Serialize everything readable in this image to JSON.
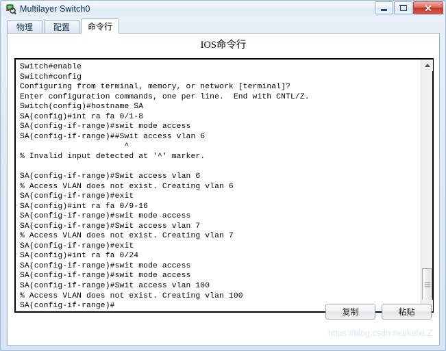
{
  "window": {
    "title": "Multilayer Switch0",
    "icon": "switch-device-icon",
    "controls": {
      "minimize": "minimize-icon",
      "maximize": "maximize-icon",
      "close": "✕"
    }
  },
  "tabs": [
    {
      "label": "物理",
      "active": false
    },
    {
      "label": "配置",
      "active": false
    },
    {
      "label": "命令行",
      "active": true
    }
  ],
  "panel": {
    "title": "IOS命令行"
  },
  "terminal": {
    "lines": [
      "Switch#enable",
      "Switch#config",
      "Configuring from terminal, memory, or network [terminal]?",
      "Enter configuration commands, one per line.  End with CNTL/Z.",
      "Switch(config)#hostname SA",
      "SA(config)#int ra fa 0/1-8",
      "SA(config-if-range)#swit mode access",
      "SA(config-if-range)##Swit access vlan 6",
      "                      ^",
      "% Invalid input detected at '^' marker.",
      "",
      "SA(config-if-range)#Swit access vlan 6",
      "% Access VLAN does not exist. Creating vlan 6",
      "SA(config-if-range)#exit",
      "SA(config)#int ra fa 0/9-16",
      "SA(config-if-range)#swit mode access",
      "SA(config-if-range)#Swit access vlan 7",
      "% Access VLAN does not exist. Creating vlan 7",
      "SA(config-if-range)#exit",
      "SA(config)#int ra fa 0/24",
      "SA(config-if-range)#swit mode access",
      "SA(config-if-range)#swit mode access",
      "SA(config-if-range)#Swit access vlan 100",
      "% Access VLAN does not exist. Creating vlan 100",
      "SA(config-if-range)#"
    ],
    "scrollbar": {
      "up_arrow": "chevron-up-icon",
      "down_arrow": "chevron-down-icon"
    }
  },
  "buttons": {
    "copy": "复制",
    "paste": "粘贴"
  },
  "watermark": "https://blog.csdn.net/kelxLZ",
  "colors": {
    "frame": "#d6e4f3",
    "accent": "#9ab0c6",
    "close": "#c5352a",
    "terminal_bg": "#ffffff",
    "terminal_fg": "#000000"
  }
}
